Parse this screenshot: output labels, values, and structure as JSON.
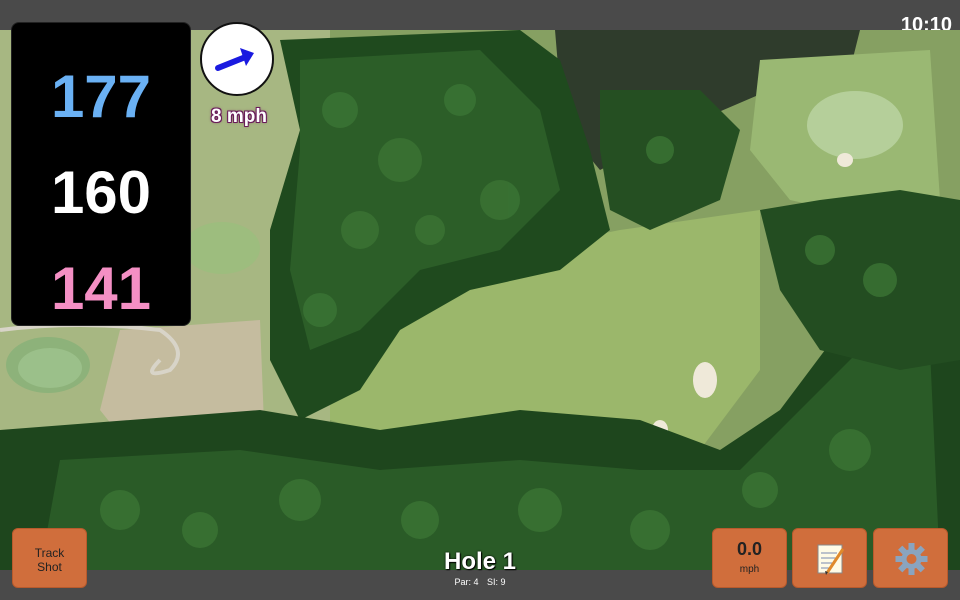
{
  "status": {
    "clock": "10:10"
  },
  "distances": {
    "back": "177",
    "middle": "160",
    "front": "141"
  },
  "wind": {
    "speed_label": "8 mph"
  },
  "hole": {
    "title": "Hole 1",
    "par": "Par: 4",
    "si": "SI: 9"
  },
  "buttons": {
    "track_shot_line1": "Track",
    "track_shot_line2": "Shot",
    "speed_value": "0.0",
    "speed_unit": "mph",
    "notes_icon": "notepad-icon",
    "settings_icon": "gear-icon"
  },
  "colors": {
    "back_distance": "#6ab1f4",
    "middle_distance": "#ffffff",
    "front_distance": "#f48fc4",
    "button": "#d06e3c",
    "wind_arrow": "#1a1ae0"
  }
}
